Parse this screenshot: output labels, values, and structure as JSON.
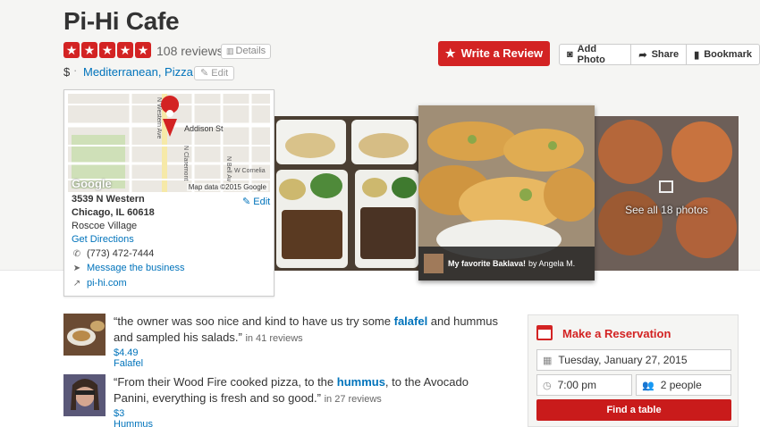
{
  "business": {
    "name": "Pi-Hi Cafe",
    "rating_stars": 5,
    "review_count": "108 reviews",
    "details_label": "Details",
    "price": "$",
    "separator": "·",
    "categories": "Mediterranean, Pizza",
    "edit_label": "Edit"
  },
  "actions": {
    "write_review": "Write a Review",
    "add_photo": "Add Photo",
    "share": "Share",
    "bookmark": "Bookmark"
  },
  "map_card": {
    "street_label": "Addison St",
    "street_v1": "N Western Ave",
    "street_v2": "N Claremont",
    "street_v3": "N Bell Av",
    "street_h2": "W Cornelia",
    "google": "Google",
    "map_credit": "Map data ©2015 Google",
    "address_line1": "3539 N Western",
    "address_line2": "Chicago, IL 60618",
    "edit": "Edit",
    "neighborhood": "Roscoe Village",
    "directions": "Get Directions",
    "phone": "(773) 472-7444",
    "message": "Message the business",
    "website": "pi-hi.com"
  },
  "photos": {
    "caption_title": "My favorite Baklava!",
    "caption_by": "by Angela M.",
    "see_all": "See all 18 photos"
  },
  "snippets": [
    {
      "quote_pre": "“the owner was soo nice and kind to have us try some ",
      "highlight": "falafel",
      "quote_post": " and hummus and sampled his salads.”",
      "in_reviews": "in 41 reviews",
      "price_item": "$4.49 Falafel"
    },
    {
      "quote_pre": "“From their Wood Fire cooked pizza, to the ",
      "highlight": "hummus",
      "quote_post": ", to the Avocado Panini, everything is fresh and so good.”",
      "in_reviews": "in 27 reviews",
      "price_item": "$3 Hummus"
    }
  ],
  "reservation": {
    "title": "Make a Reservation",
    "date": "Tuesday, January 27, 2015",
    "time": "7:00 pm",
    "people": "2 people",
    "find_button": "Find a table"
  },
  "colors": {
    "brand_red": "#d32323",
    "link_blue": "#0073bb"
  }
}
